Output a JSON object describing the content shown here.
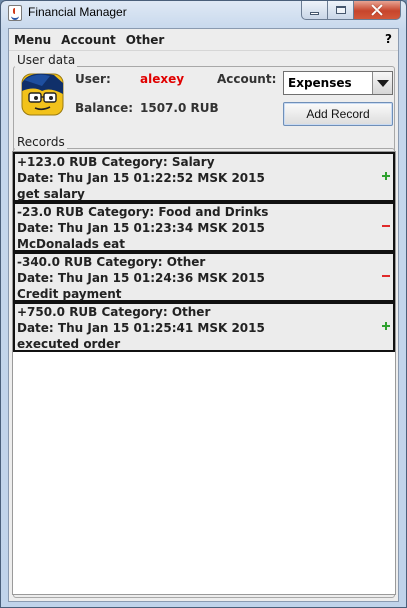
{
  "window": {
    "title": "Financial Manager"
  },
  "menubar": {
    "items": [
      "Menu",
      "Account",
      "Other"
    ],
    "help": "?"
  },
  "user_data": {
    "section_label": "User data",
    "user_label": "User:",
    "user_value": "alexey",
    "account_label": "Account:",
    "account_selected": "Expenses",
    "balance_label": "Balance:",
    "balance_value": "1507.0 RUB",
    "add_record_label": "Add Record",
    "avatar_icon": "user-avatar-icon"
  },
  "records": {
    "section_label": "Records",
    "items": [
      {
        "line1": "+123.0 RUB   Category: Salary",
        "line2": "Date: Thu Jan 15 01:22:52 MSK 2015",
        "line3": "get salary",
        "sign": "plus"
      },
      {
        "line1": "-23.0 RUB   Category: Food and Drinks",
        "line2": "Date: Thu Jan 15 01:23:34 MSK 2015",
        "line3": "McDonalads eat",
        "sign": "minus"
      },
      {
        "line1": "-340.0 RUB   Category: Other",
        "line2": "Date: Thu Jan 15 01:24:36 MSK 2015",
        "line3": "Credit payment",
        "sign": "minus"
      },
      {
        "line1": "+750.0 RUB   Category: Other",
        "line2": "Date: Thu Jan 15 01:25:41 MSK 2015",
        "line3": "executed order",
        "sign": "plus"
      }
    ]
  },
  "colors": {
    "user_value": "#e00000",
    "plus": "#2fa12f",
    "minus": "#e02a2a"
  }
}
